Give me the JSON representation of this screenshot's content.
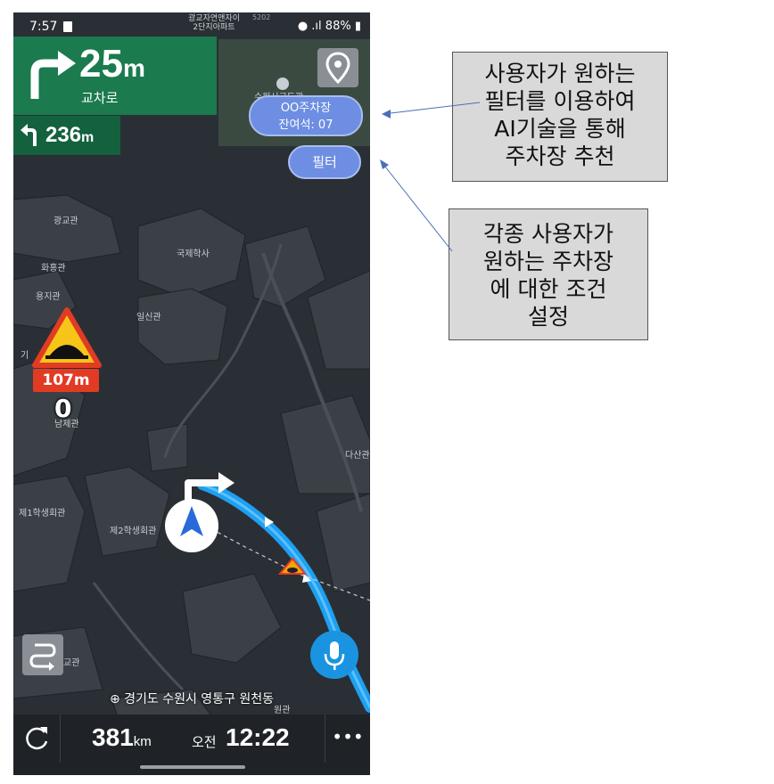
{
  "status_bar": {
    "time": "7:57",
    "center_line1": "광교자연앤자이",
    "center_line2": "2단지아파트",
    "code": "5202",
    "battery": "88%"
  },
  "guidance": {
    "distance_value": "25",
    "distance_unit": "m",
    "road": "교차로",
    "next_distance_value": "236",
    "next_distance_unit": "m"
  },
  "parking": {
    "name": "OO주차장",
    "availability": "잔여석: 07"
  },
  "filter_button": "필터",
  "hazard": {
    "distance": "107m",
    "speed": "0"
  },
  "map_labels": {
    "gwanggyo": "광교관",
    "international": "국제학사",
    "hwahong": "화홍관",
    "yongji": "용지관",
    "ilsin": "일신관",
    "namje": "남제관",
    "dasan": "다산관",
    "student1": "제1학생회관",
    "student2": "제2학생회관",
    "hall_bottom": "교관",
    "bottom": "원관",
    "partial_left": "기",
    "partial_top": "수원시구도관"
  },
  "address": "경기도 수원시 영통구 원천동",
  "bottom_bar": {
    "remaining_value": "381",
    "remaining_unit": "km",
    "eta_label": "오전",
    "eta_time": "12:22",
    "more": "•••"
  },
  "annotations": {
    "callout1": [
      "사용자가 원하는",
      "필터를 이용하여",
      "AI기술을 통해",
      "주차장 추천"
    ],
    "callout2": [
      "각종 사용자가",
      "원하는 주차장",
      "에 대한 조건",
      "설정"
    ]
  },
  "colors": {
    "guidance_green": "#1b7a4e",
    "route_blue": "#1ea0f0",
    "bubble_blue": "#6d8ee3",
    "hazard_red": "#e23b24"
  }
}
